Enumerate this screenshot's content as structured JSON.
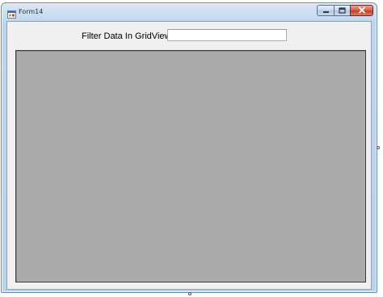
{
  "window": {
    "title": "Form14",
    "icon": "form-icon",
    "caption_buttons": [
      "minimize-icon",
      "maximize-icon",
      "close-icon"
    ]
  },
  "form": {
    "filter_label": "Filter Data In GridView",
    "filter_value": "",
    "filter_placeholder": ""
  },
  "gridview": {
    "background_color": "#ababab"
  },
  "colors": {
    "title_bar": "#c9dbf0",
    "close_button": "#c43d2b",
    "client_background": "#f0f0f0"
  }
}
